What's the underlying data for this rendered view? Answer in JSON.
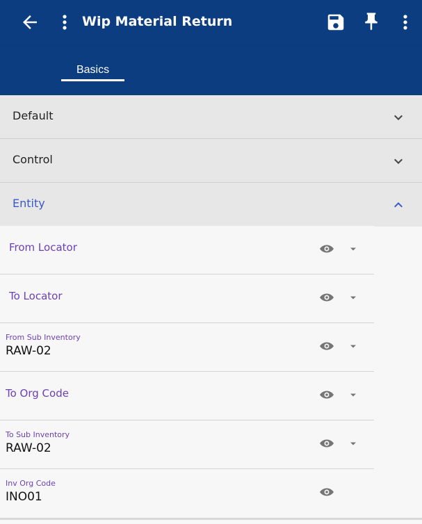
{
  "appbar": {
    "title": "Wip Material Return",
    "bg_color": "#0b3d80",
    "icons": [
      "arrow-back-icon",
      "more-vert-icon",
      "save-icon",
      "pin-icon",
      "more-vert-icon"
    ]
  },
  "tabs": [
    {
      "label": "Basics",
      "active": true
    }
  ],
  "sections": {
    "default": {
      "label": "Default",
      "expanded": false
    },
    "control": {
      "label": "Control",
      "expanded": false
    },
    "entity": {
      "label": "Entity",
      "expanded": true
    }
  },
  "fields": {
    "from_locator": {
      "label": "From Locator",
      "value": ""
    },
    "to_locator": {
      "label": "To Locator",
      "value": ""
    },
    "from_sub_inventory": {
      "label": "From Sub Inventory",
      "value": "RAW-02"
    },
    "to_org_code": {
      "label": "To Org Code",
      "value": ""
    },
    "to_sub_inventory": {
      "label": "To Sub Inventory",
      "value": "RAW-02"
    },
    "inv_org_code": {
      "label": "Inv Org Code",
      "value": "INO01"
    }
  },
  "colors": {
    "accent_label": "#6b3fb8",
    "expanded_section": "#3a5ac8"
  }
}
